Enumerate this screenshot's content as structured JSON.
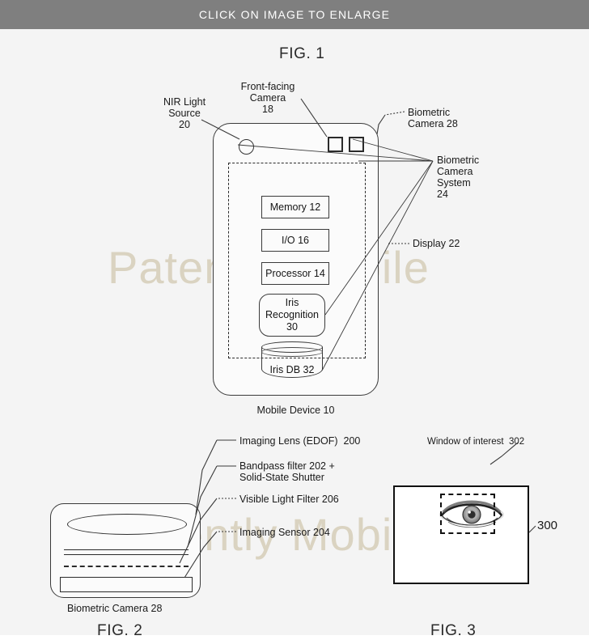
{
  "banner": {
    "text": "CLICK ON IMAGE TO ENLARGE",
    "background": "#7f7f7f",
    "text_color": "#ffffff"
  },
  "watermark": {
    "text": "Patently Mobile",
    "color": "#d8d1bd",
    "occurrences": 2
  },
  "figures": {
    "fig1": {
      "title": "FIG. 1",
      "device_label": "Mobile Device 10",
      "callouts": {
        "nir_light_source": "NIR Light\nSource\n20",
        "front_facing_camera": "Front-facing\nCamera\n18",
        "biometric_camera": "Biometric\nCamera 28",
        "biometric_camera_system": "Biometric\nCamera\nSystem\n24",
        "display": "Display 22"
      },
      "blocks": [
        {
          "name": "memory",
          "label": "Memory 12",
          "shape": "rect"
        },
        {
          "name": "io",
          "label": "I/O 16",
          "shape": "rect"
        },
        {
          "name": "processor",
          "label": "Processor 14",
          "shape": "rect"
        },
        {
          "name": "iris-recognition",
          "label": "Iris\nRecognition\n30",
          "shape": "rounded-rect"
        },
        {
          "name": "iris-db",
          "label": "Iris DB 32",
          "shape": "cylinder"
        }
      ]
    },
    "fig2": {
      "title": "FIG. 2",
      "caption": "Biometric Camera 28",
      "callouts": {
        "imaging_lens": "Imaging Lens (EDOF)  200",
        "bandpass_filter": "Bandpass filter 202 +\nSolid-State Shutter",
        "visible_light_filter": "Visible Light Filter 206",
        "imaging_sensor": "Imaging Sensor 204"
      }
    },
    "fig3": {
      "title": "FIG. 3",
      "callouts": {
        "window_of_interest": "Window of interest  302",
        "frame_number": "300"
      }
    }
  }
}
